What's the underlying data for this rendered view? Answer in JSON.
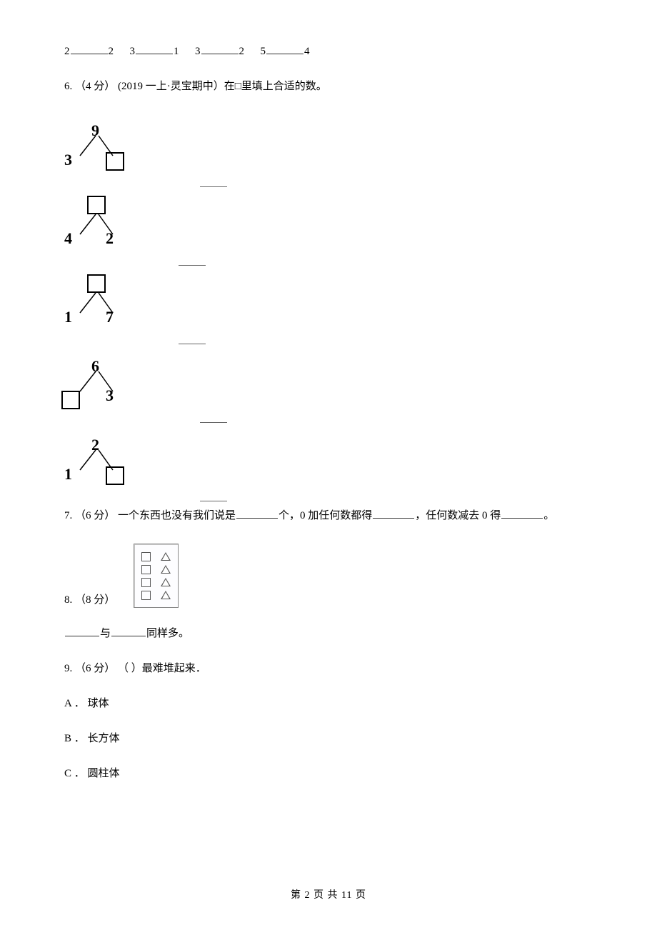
{
  "line_top": {
    "a1": "2",
    "a2": "2",
    "b1": "3",
    "b2": "1",
    "c1": "3",
    "c2": "2",
    "d1": "5",
    "d2": "4"
  },
  "q6": {
    "prefix": "6. （4 分） (2019 一上·灵宝期中）在□里填上合适的数。",
    "bonds": [
      {
        "top": "9",
        "left": "3",
        "right_box": true
      },
      {
        "top_box": true,
        "left": "4",
        "right": "2"
      },
      {
        "top_box": true,
        "left": "1",
        "right": "7"
      },
      {
        "top": "6",
        "left_box": true,
        "right": "3"
      },
      {
        "top": "2",
        "left": "1",
        "right_box": true
      }
    ]
  },
  "q7": {
    "prefix": "7. （6 分） 一个东西也没有我们说是",
    "mid1": "个，0 加任何数都得",
    "mid2": "，任何数减去 0 得",
    "end": "。"
  },
  "q8": {
    "prefix": "8. （8 分）",
    "line2a": "与",
    "line2b": "同样多。"
  },
  "q9": {
    "text": "9. （6 分） （    ）最难堆起来．",
    "opts": [
      "A ．  球体",
      "B ．  长方体",
      "C ．  圆柱体"
    ]
  },
  "footer": "第 2 页 共 11 页"
}
